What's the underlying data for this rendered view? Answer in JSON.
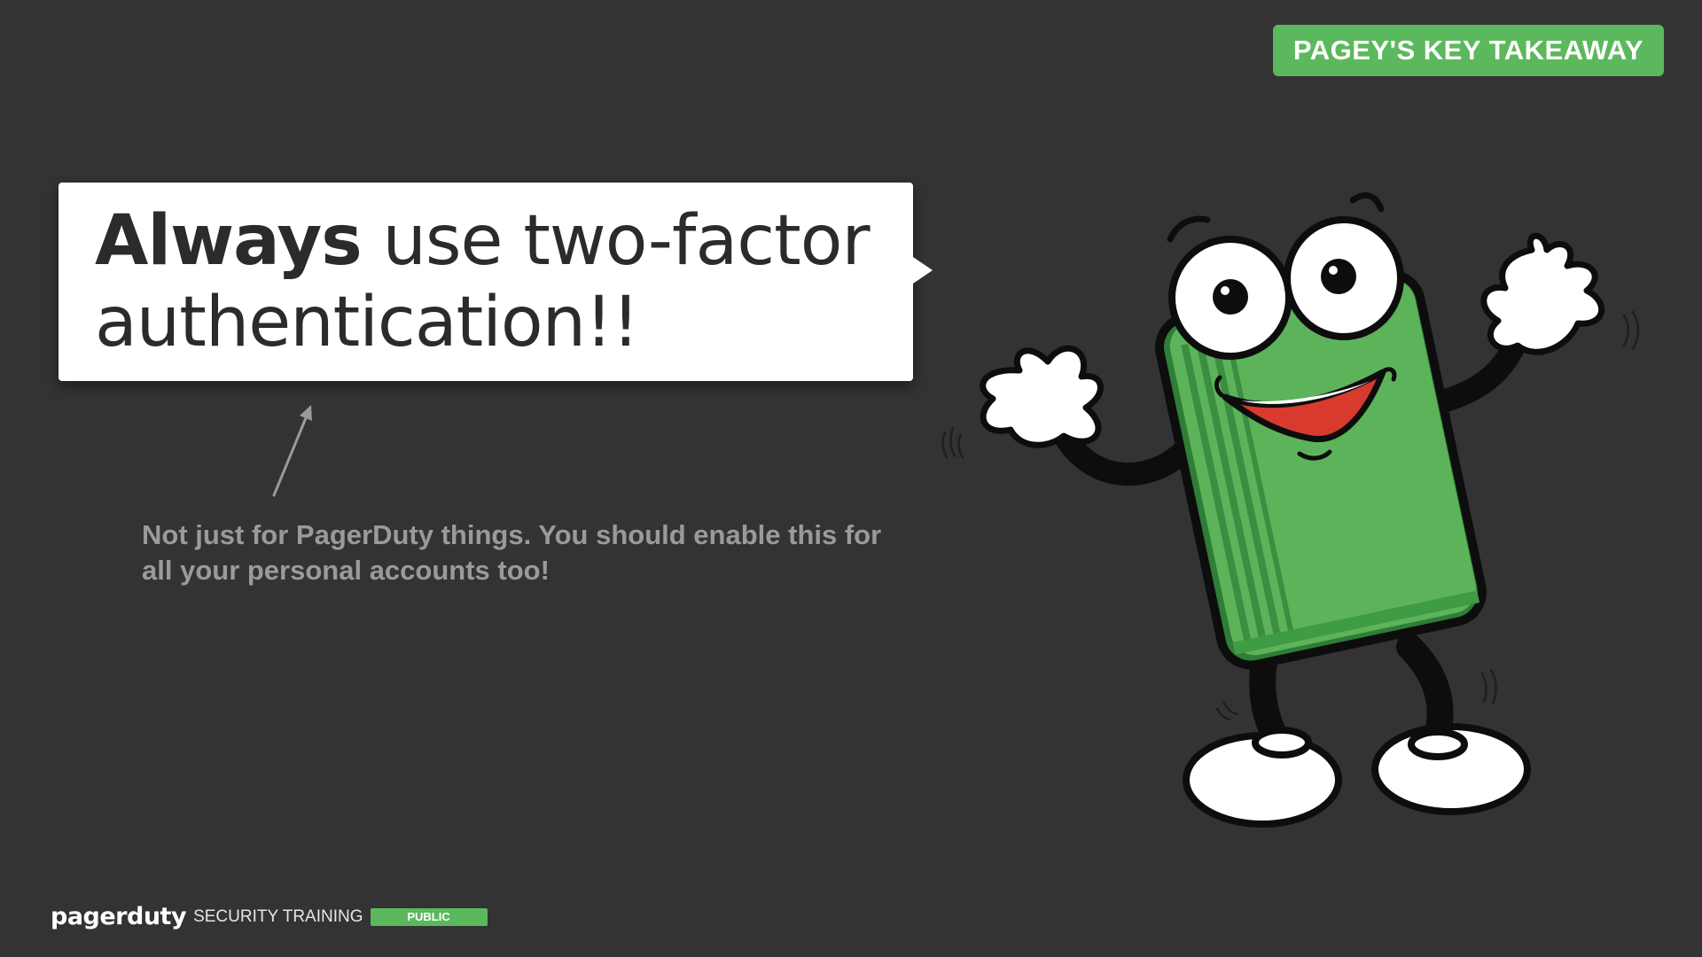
{
  "badge": {
    "label": "PAGEY'S KEY TAKEAWAY"
  },
  "callout": {
    "emphasis": "Always",
    "text": " use two-factor authentication!!"
  },
  "note": {
    "text": "Not just for PagerDuty things. You should enable this for all your personal accounts too!"
  },
  "footer": {
    "logo": "pagerduty",
    "label": "SECURITY TRAINING",
    "tag": "PUBLIC"
  },
  "colors": {
    "background": "#333333",
    "accent_green": "#5cb85c",
    "callout_bg": "#ffffff",
    "note_text": "#9a9a9a"
  },
  "illustration": {
    "icon": "pagey-mascot-icon"
  }
}
